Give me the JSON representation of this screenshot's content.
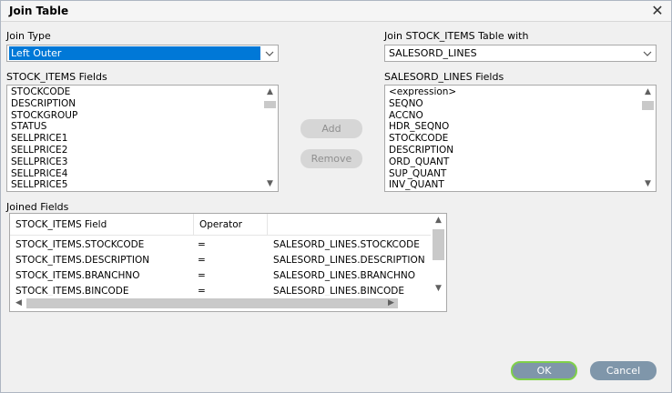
{
  "window": {
    "title": "Join Table"
  },
  "join_type": {
    "label": "Join Type",
    "value": "Left Outer"
  },
  "join_with": {
    "label": "Join STOCK_ITEMS Table with",
    "value": "SALESORD_LINES"
  },
  "left_fields": {
    "label": "STOCK_ITEMS Fields",
    "items": [
      "STOCKCODE",
      "DESCRIPTION",
      "STOCKGROUP",
      "STATUS",
      "SELLPRICE1",
      "SELLPRICE2",
      "SELLPRICE3",
      "SELLPRICE4",
      "SELLPRICE5"
    ]
  },
  "right_fields": {
    "label": "SALESORD_LINES Fields",
    "items": [
      "<expression>",
      "SEQNO",
      "ACCNO",
      "HDR_SEQNO",
      "STOCKCODE",
      "DESCRIPTION",
      "ORD_QUANT",
      "SUP_QUANT",
      "INV_QUANT"
    ]
  },
  "buttons": {
    "add": "Add",
    "remove": "Remove",
    "ok": "OK",
    "cancel": "Cancel"
  },
  "joined": {
    "label": "Joined Fields",
    "columns": [
      "STOCK_ITEMS Field",
      "Operator",
      ""
    ],
    "rows": [
      [
        "STOCK_ITEMS.STOCKCODE",
        "=",
        "SALESORD_LINES.STOCKCODE"
      ],
      [
        "STOCK_ITEMS.DESCRIPTION",
        "=",
        "SALESORD_LINES.DESCRIPTION"
      ],
      [
        "STOCK_ITEMS.BRANCHNO",
        "=",
        "SALESORD_LINES.BRANCHNO"
      ],
      [
        "STOCK_ITEMS.BINCODE",
        "=",
        "SALESORD_LINES.BINCODE"
      ]
    ]
  },
  "icons": {
    "close": "close-icon",
    "chevron": "chevron-down-icon"
  },
  "colors": {
    "selection": "#0078d7",
    "button": "#7f96aa",
    "ok_border": "#7fd04a"
  }
}
